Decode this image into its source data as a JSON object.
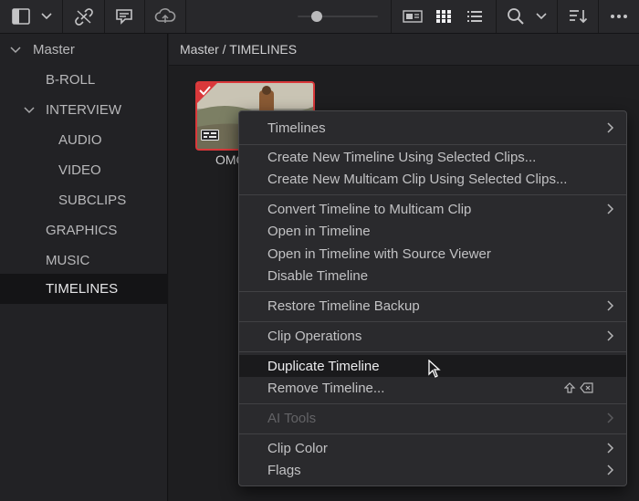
{
  "toolbar": {
    "icons": [
      "sidebar-toggle-icon",
      "chevron-down-icon",
      "link-broken-icon",
      "metadata-icon",
      "cloud-icon",
      "zoom-slider",
      "metadata-view-icon",
      "grid-view-icon",
      "list-view-icon",
      "search-icon",
      "chevron-down-icon",
      "sort-icon",
      "more-icon"
    ],
    "zoom_level": 0.25
  },
  "sidebar": {
    "items": [
      {
        "label": "Master",
        "level": 0,
        "expanded": true
      },
      {
        "label": "B-ROLL",
        "level": 1
      },
      {
        "label": "INTERVIEW",
        "level": 1,
        "expanded": true
      },
      {
        "label": "AUDIO",
        "level": 2
      },
      {
        "label": "VIDEO",
        "level": 2
      },
      {
        "label": "SUBCLIPS",
        "level": 2
      },
      {
        "label": "GRAPHICS",
        "level": 1
      },
      {
        "label": "MUSIC",
        "level": 1
      },
      {
        "label": "TIMELINES",
        "level": 1,
        "selected": true
      }
    ]
  },
  "main": {
    "breadcrumb": "Master / TIMELINES",
    "clip": {
      "name": "OMG",
      "selected_color": "#d9383a"
    }
  },
  "context_menu": {
    "groups": [
      [
        {
          "label": "Timelines",
          "submenu": true
        }
      ],
      [
        {
          "label": "Create New Timeline Using Selected Clips..."
        },
        {
          "label": "Create New Multicam Clip Using Selected Clips..."
        }
      ],
      [
        {
          "label": "Convert Timeline to Multicam Clip",
          "submenu": true
        },
        {
          "label": "Open in Timeline"
        },
        {
          "label": "Open in Timeline with Source Viewer"
        },
        {
          "label": "Disable Timeline"
        }
      ],
      [
        {
          "label": "Restore Timeline Backup",
          "submenu": true
        }
      ],
      [
        {
          "label": "Clip Operations",
          "submenu": true
        }
      ],
      [
        {
          "label": "Duplicate Timeline",
          "highlighted": true
        },
        {
          "label": "Remove Timeline...",
          "shortcut": "shift-delete-icon"
        }
      ],
      [
        {
          "label": "AI Tools",
          "submenu": true,
          "disabled": true
        }
      ],
      [
        {
          "label": "Clip Color",
          "submenu": true
        },
        {
          "label": "Flags",
          "submenu": true
        }
      ]
    ]
  },
  "colors": {
    "accent": "#d9383a",
    "background": "#1e1e20",
    "menu": "#2a2a2d"
  }
}
